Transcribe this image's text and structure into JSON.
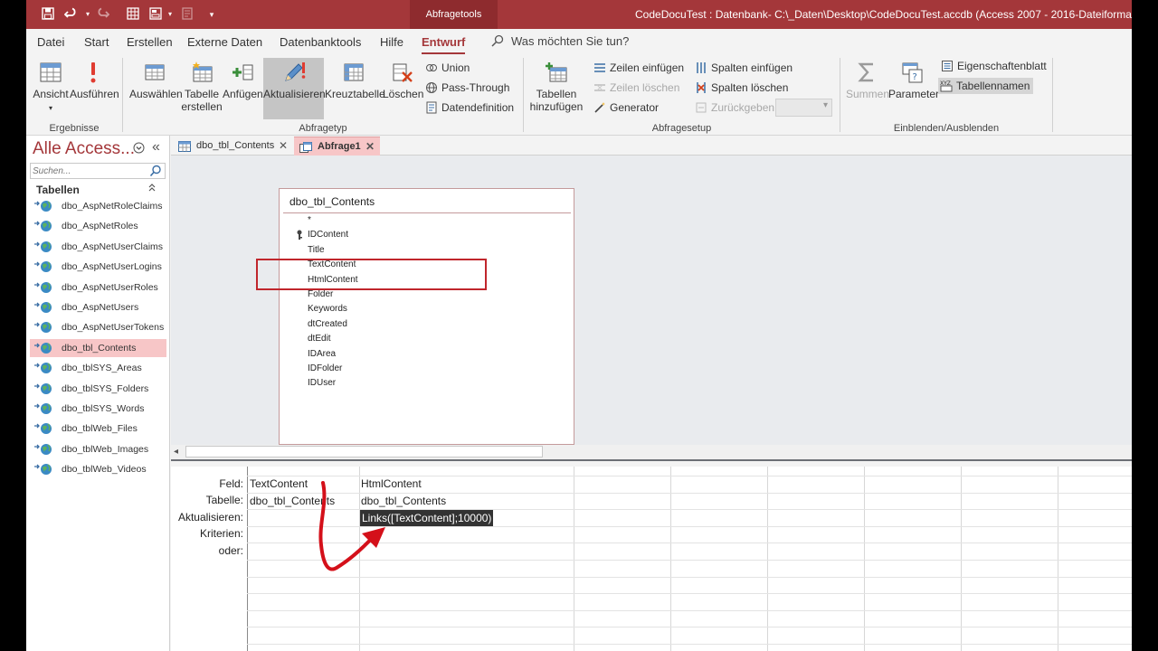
{
  "titlebar": {
    "context_tab": "Abfragetools",
    "window_title": "CodeDocuTest : Datenbank- C:\\_Daten\\Desktop\\CodeDocuTest.accdb (Access 2007 - 2016-Dateiformat) - Acce",
    "quick_access": [
      "save-icon",
      "undo-icon",
      "redo-icon",
      "table-icon",
      "form-icon",
      "report-icon",
      "customize-icon"
    ]
  },
  "ribbon_tabs": [
    "Datei",
    "Start",
    "Erstellen",
    "Externe Daten",
    "Datenbanktools",
    "Hilfe",
    "Entwurf"
  ],
  "active_tab": "Entwurf",
  "tell_me": "Was möchten Sie tun?",
  "ribbon": {
    "ergebnisse": {
      "label": "Ergebnisse",
      "ansicht": "Ansicht",
      "ausfuehren": "Ausführen"
    },
    "abfragetyp": {
      "label": "Abfragetyp",
      "auswaehlen": "Auswählen",
      "tabelle_erstellen_1": "Tabelle",
      "tabelle_erstellen_2": "erstellen",
      "anfuegen": "Anfügen",
      "aktualisieren": "Aktualisieren",
      "kreuztabelle": "Kreuztabelle",
      "loeschen": "Löschen",
      "union": "Union",
      "pass_through": "Pass-Through",
      "datendefinition": "Datendefinition"
    },
    "abfragesetup": {
      "label": "Abfragesetup",
      "tabellen_hinzufuegen_1": "Tabellen",
      "tabellen_hinzufuegen_2": "hinzufügen",
      "zeilen_einfuegen": "Zeilen einfügen",
      "zeilen_loeschen": "Zeilen löschen",
      "generator": "Generator",
      "spalten_einfuegen": "Spalten einfügen",
      "spalten_loeschen": "Spalten löschen",
      "zurueckgeben": "Zurückgeben:"
    },
    "einblenden": {
      "label": "Einblenden/Ausblenden",
      "summen": "Summen",
      "parameter": "Parameter",
      "eigenschaftenblatt": "Eigenschaftenblatt",
      "tabellennamen": "Tabellennamen"
    }
  },
  "nav": {
    "title": "Alle Access...",
    "search_placeholder": "Suchen...",
    "group": "Tabellen",
    "items": [
      "dbo_AspNetRoleClaims",
      "dbo_AspNetRoles",
      "dbo_AspNetUserClaims",
      "dbo_AspNetUserLogins",
      "dbo_AspNetUserRoles",
      "dbo_AspNetUsers",
      "dbo_AspNetUserTokens",
      "dbo_tbl_Contents",
      "dbo_tblSYS_Areas",
      "dbo_tblSYS_Folders",
      "dbo_tblSYS_Words",
      "dbo_tblWeb_Files",
      "dbo_tblWeb_Images",
      "dbo_tblWeb_Videos"
    ],
    "selected_item": "dbo_tbl_Contents"
  },
  "doc_tabs": [
    {
      "label": "dbo_tbl_Contents",
      "icon": "table-icon",
      "active": false
    },
    {
      "label": "Abfrage1",
      "icon": "query-icon",
      "active": true
    }
  ],
  "field_list": {
    "title": "dbo_tbl_Contents",
    "fields": [
      "*",
      "IDContent",
      "Title",
      "TextContent",
      "HtmlContent",
      "Folder",
      "Keywords",
      "dtCreated",
      "dtEdit",
      "IDArea",
      "IDFolder",
      "IDUser"
    ],
    "primary_key": "IDContent",
    "highlighted": [
      "TextContent",
      "HtmlContent"
    ]
  },
  "qbe": {
    "row_labels": [
      "Feld:",
      "Tabelle:",
      "Aktualisieren:",
      "Kriterien:",
      "oder:"
    ],
    "columns": [
      {
        "feld": "TextContent",
        "tabelle": "dbo_tbl_Contents",
        "aktualisieren": ""
      },
      {
        "feld": "HtmlContent",
        "tabelle": "dbo_tbl_Contents",
        "aktualisieren": "Links([TextContent];10000)"
      }
    ]
  },
  "colors": {
    "accent": "#a4373a",
    "selection_pink": "#f7c6c7",
    "annotation_red": "#d4101a"
  }
}
